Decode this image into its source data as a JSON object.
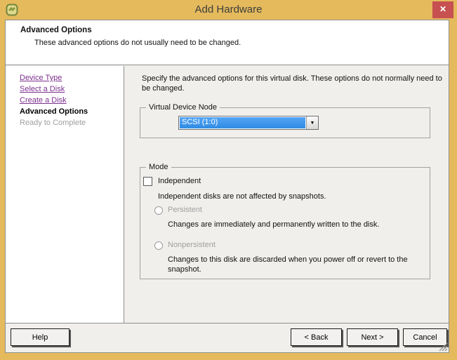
{
  "window": {
    "title": "Add Hardware"
  },
  "icons": {
    "close_glyph": "✕",
    "dropdown_arrow_glyph": "▼"
  },
  "header": {
    "title": "Advanced Options",
    "subtitle": "These advanced options do not usually need to be changed."
  },
  "sidebar": {
    "items": [
      {
        "label": "Device Type",
        "state": "visited-link"
      },
      {
        "label": "Select a Disk",
        "state": "visited-link"
      },
      {
        "label": "Create a Disk",
        "state": "visited-link"
      },
      {
        "label": "Advanced Options",
        "state": "current"
      },
      {
        "label": "Ready to Complete",
        "state": "disabled"
      }
    ]
  },
  "main": {
    "intro": "Specify the advanced options for this virtual disk. These options do not normally need to be changed.",
    "device_node_group": {
      "legend": "Virtual Device Node",
      "selected_value": "SCSI (1:0)"
    },
    "mode_group": {
      "legend": "Mode",
      "independent_checkbox": {
        "label": "Independent",
        "checked": false,
        "description": "Independent disks are not affected by snapshots."
      },
      "options": [
        {
          "label": "Persistent",
          "description": "Changes are immediately and permanently written to the disk.",
          "enabled": false,
          "selected": false
        },
        {
          "label": "Nonpersistent",
          "description": "Changes to this disk are discarded when you power off or revert to the snapshot.",
          "enabled": false,
          "selected": false
        }
      ]
    }
  },
  "footer": {
    "help_label": "Help",
    "back_label": "< Back",
    "next_label": "Next >",
    "cancel_label": "Cancel"
  },
  "colors": {
    "frame": "#e4ba5c",
    "close_button": "#c75050",
    "selection_blue": "#54a5f5",
    "link_purple": "#7c2f8e",
    "disabled_gray": "#9f9f9f"
  }
}
